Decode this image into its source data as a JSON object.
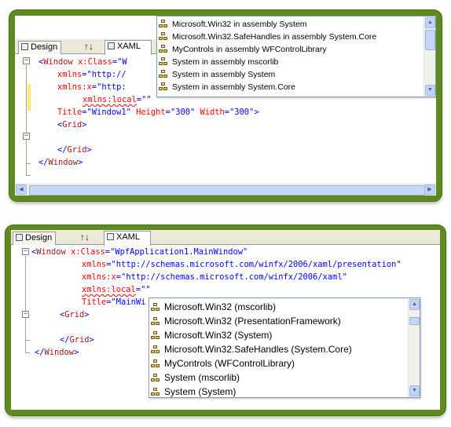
{
  "top_panel": {
    "tabs": {
      "design": "Design",
      "swap": "↑↓",
      "xaml": "XAML"
    },
    "code_lines": [
      {
        "tag": "Window",
        "attr": "x:Class",
        "value": "W"
      },
      {
        "attr": "xmlns",
        "value": "\"http://"
      },
      {
        "attr": "xmlns:x",
        "value": "\"http:"
      },
      {
        "attr": "xmlns:local",
        "value": "\"\""
      },
      {
        "attr": "Title",
        "value": "\"Window1\"",
        "attr2": "Height",
        "value2": "\"300\"",
        "attr3": "Width",
        "value3": "\"300\""
      },
      {
        "tag": "Grid"
      },
      {
        "close_tag": "Grid"
      },
      {
        "close_tag": "Window"
      }
    ],
    "completion_items": [
      "Microsoft.Win32 in assembly System",
      "Microsoft.Win32.SafeHandles in assembly System.Core",
      "MyControls in assembly WFControlLibrary",
      "System in assembly mscorlib",
      "System in assembly System",
      "System in assembly System.Core"
    ],
    "icons": {
      "namespace_item": "namespace-icon",
      "scroll_up": "scroll-up-arrow-icon",
      "scroll_down": "scroll-down-arrow-icon",
      "scroll_left": "scroll-left-arrow-icon",
      "scroll_right": "scroll-right-arrow-icon"
    }
  },
  "bottom_panel": {
    "tabs": {
      "design": "Design",
      "swap": "↑↓",
      "xaml": "XAML"
    },
    "code_lines": [
      {
        "tag": "Window",
        "attr": "x:Class",
        "value": "\"WpfApplication1.MainWindow\""
      },
      {
        "attr": "xmlns",
        "value": "\"http://schemas.microsoft.com/winfx/2006/xaml/presentation\""
      },
      {
        "attr": "xmlns:x",
        "value": "\"http://schemas.microsoft.com/winfx/2006/xaml\""
      },
      {
        "attr": "xmlns:local",
        "value": "\"\""
      },
      {
        "attr": "Title",
        "value": "\"MainWi"
      },
      {
        "tag": "Grid"
      },
      {
        "close_tag": "Grid"
      },
      {
        "close_tag": "Window"
      }
    ],
    "completion_items": [
      "Microsoft.Win32 (mscorlib)",
      "Microsoft.Win32 (PresentationFramework)",
      "Microsoft.Win32 (System)",
      "Microsoft.Win32.SafeHandles (System.Core)",
      "MyControls (WFControlLibrary)",
      "System (mscorlib)",
      "System (System)"
    ]
  },
  "colors": {
    "frame_green": "#5f8a1e",
    "tag": "#a31515",
    "attribute": "#ff0000",
    "value": "#0000ff",
    "change_bar": "#ffee62"
  }
}
